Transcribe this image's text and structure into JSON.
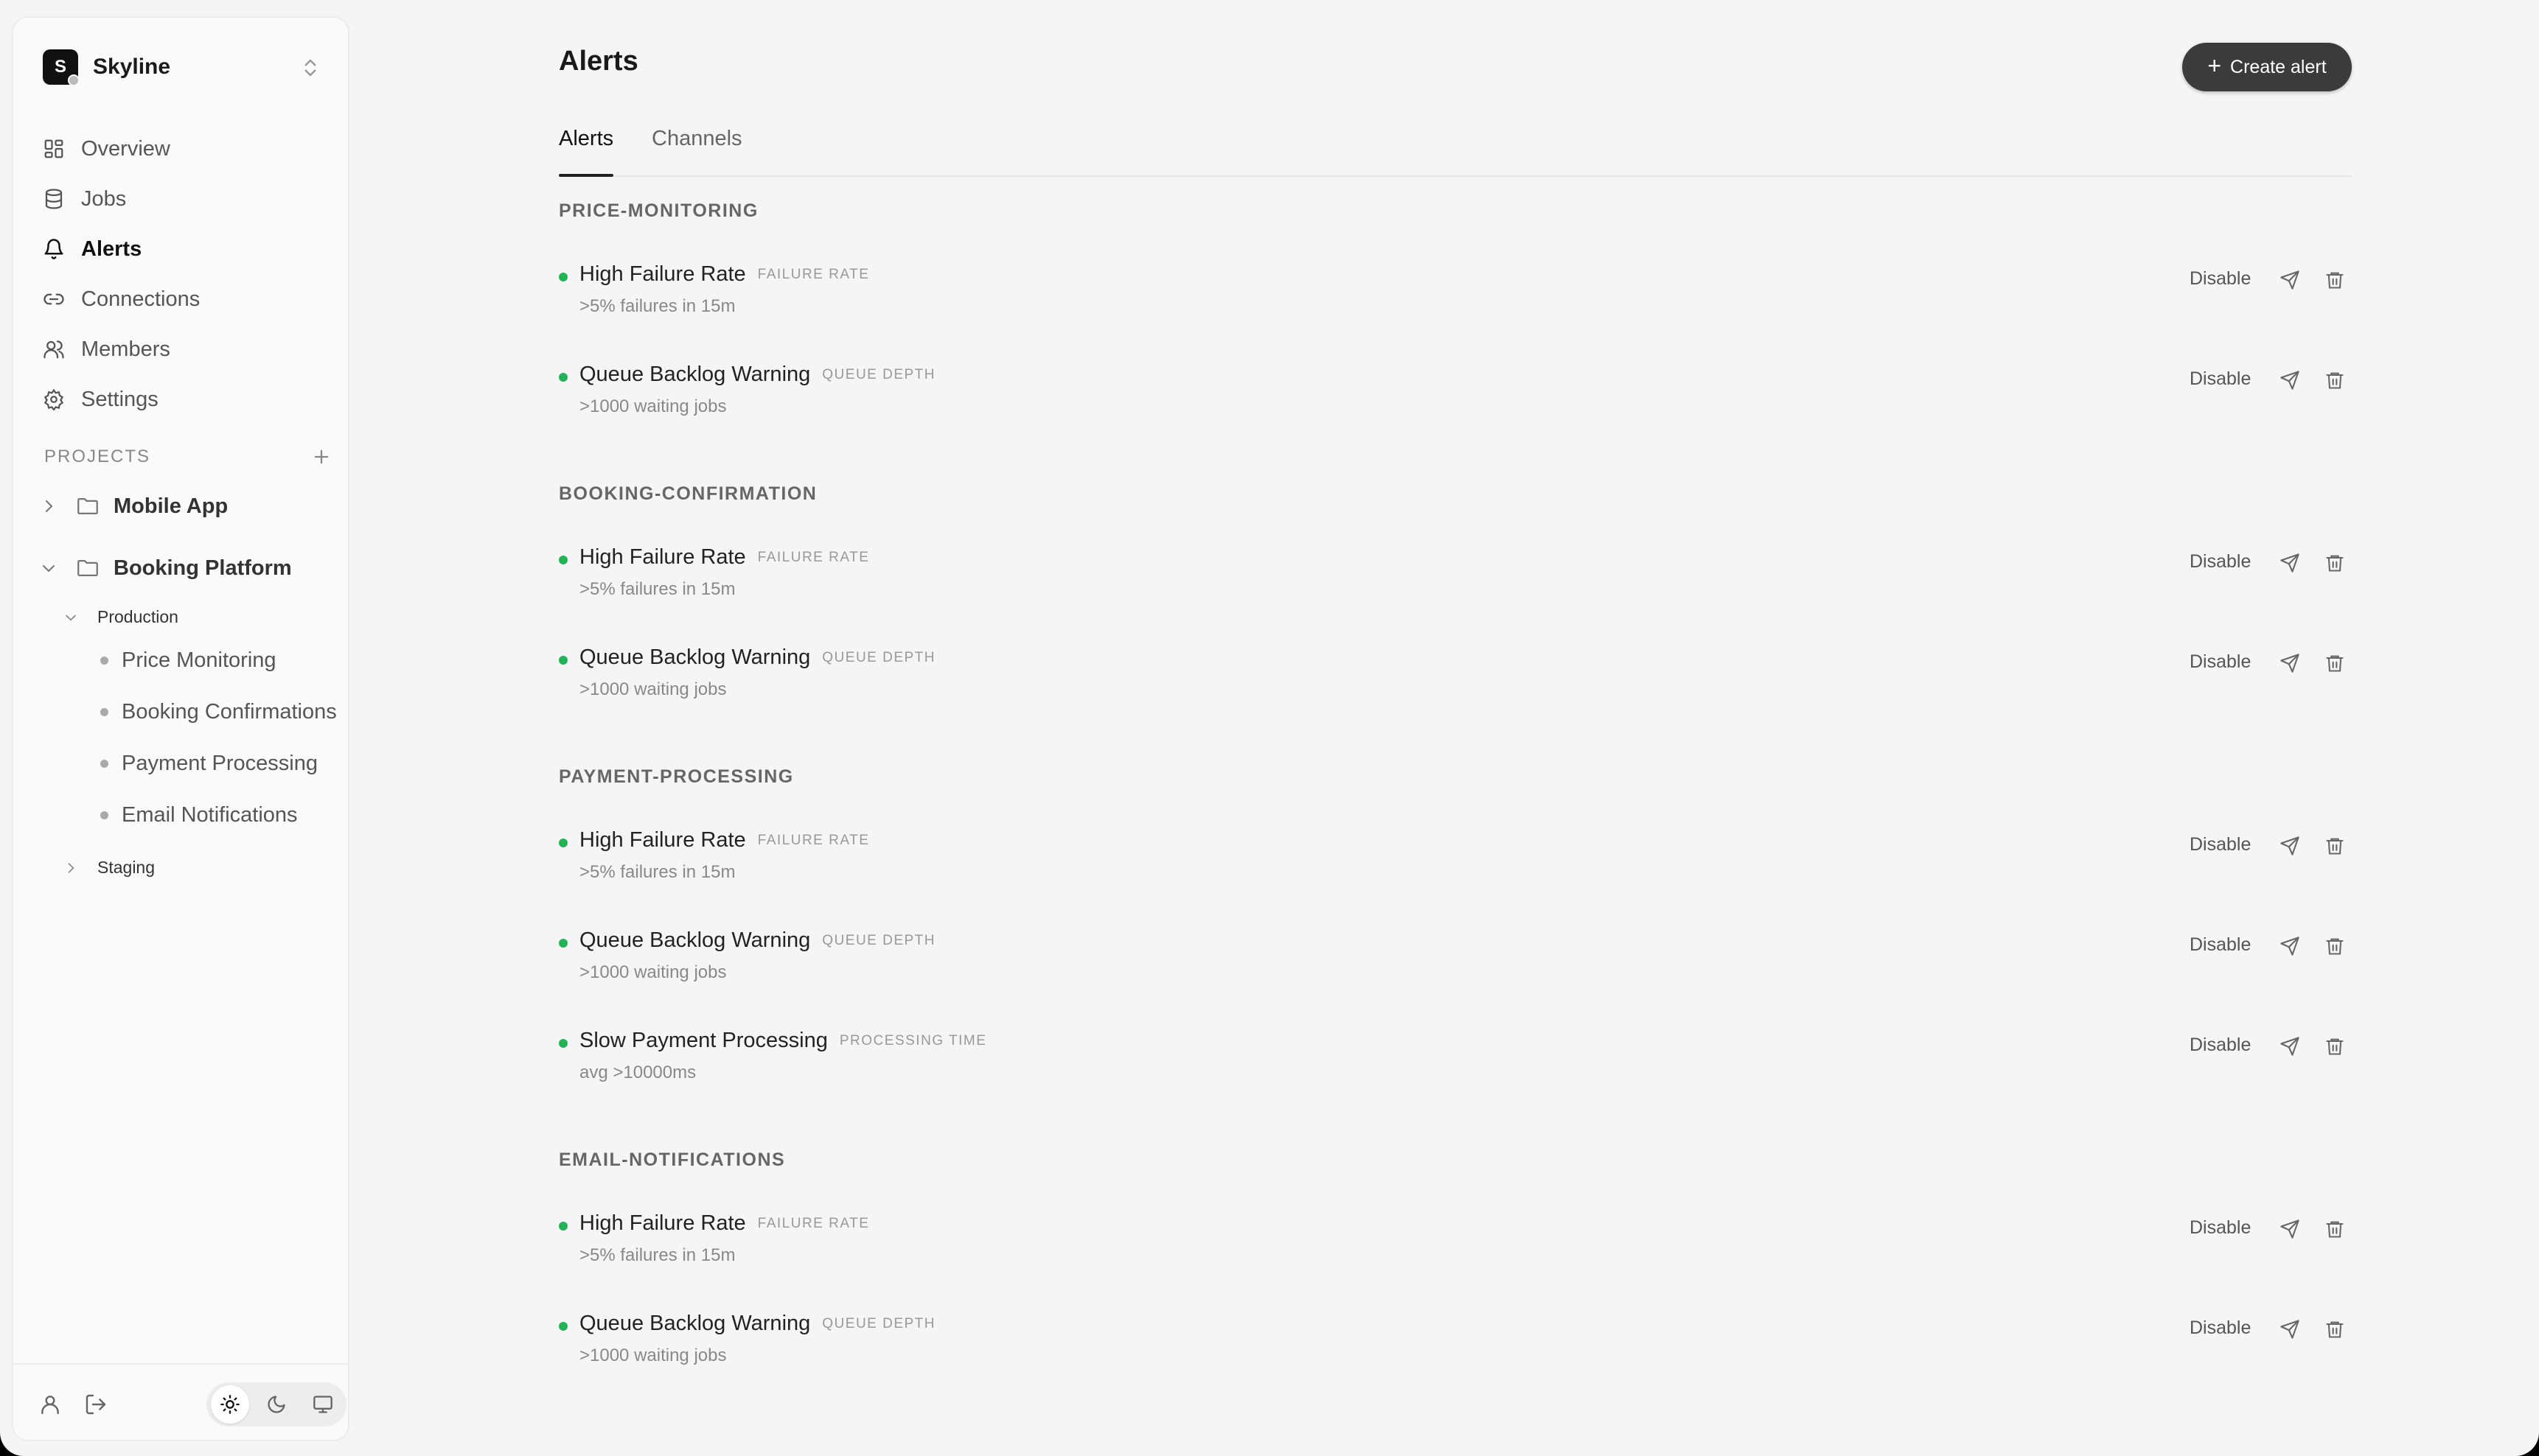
{
  "brand": {
    "logo_letter": "S",
    "name": "Skyline"
  },
  "nav": [
    {
      "label": "Overview",
      "icon": "grid-icon",
      "active": false
    },
    {
      "label": "Jobs",
      "icon": "database-icon",
      "active": false
    },
    {
      "label": "Alerts",
      "icon": "bell-icon",
      "active": true
    },
    {
      "label": "Connections",
      "icon": "link-icon",
      "active": false
    },
    {
      "label": "Members",
      "icon": "users-icon",
      "active": false
    },
    {
      "label": "Settings",
      "icon": "gear-icon",
      "active": false
    }
  ],
  "projects": {
    "title": "PROJECTS",
    "items": [
      {
        "label": "Mobile App",
        "expanded": false
      },
      {
        "label": "Booking Platform",
        "expanded": true,
        "environments": [
          {
            "label": "Production",
            "expanded": true,
            "leaves": [
              "Price Monitoring",
              "Booking Confirmations",
              "Payment Processing",
              "Email Notifications"
            ]
          },
          {
            "label": "Staging",
            "expanded": false
          }
        ]
      }
    ]
  },
  "page": {
    "title": "Alerts",
    "create_label": "Create alert"
  },
  "tabs": [
    {
      "label": "Alerts",
      "active": true
    },
    {
      "label": "Channels",
      "active": false
    }
  ],
  "groups": [
    {
      "name": "PRICE-MONITORING",
      "alerts": [
        {
          "name": "High Failure Rate",
          "type": "FAILURE RATE",
          "condition": ">5% failures in 15m"
        },
        {
          "name": "Queue Backlog Warning",
          "type": "QUEUE DEPTH",
          "condition": ">1000 waiting jobs"
        }
      ]
    },
    {
      "name": "BOOKING-CONFIRMATION",
      "alerts": [
        {
          "name": "High Failure Rate",
          "type": "FAILURE RATE",
          "condition": ">5% failures in 15m"
        },
        {
          "name": "Queue Backlog Warning",
          "type": "QUEUE DEPTH",
          "condition": ">1000 waiting jobs"
        }
      ]
    },
    {
      "name": "PAYMENT-PROCESSING",
      "alerts": [
        {
          "name": "High Failure Rate",
          "type": "FAILURE RATE",
          "condition": ">5% failures in 15m"
        },
        {
          "name": "Queue Backlog Warning",
          "type": "QUEUE DEPTH",
          "condition": ">1000 waiting jobs"
        },
        {
          "name": "Slow Payment Processing",
          "type": "PROCESSING TIME",
          "condition": "avg >10000ms"
        }
      ]
    },
    {
      "name": "EMAIL-NOTIFICATIONS",
      "alerts": [
        {
          "name": "High Failure Rate",
          "type": "FAILURE RATE",
          "condition": ">5% failures in 15m"
        },
        {
          "name": "Queue Backlog Warning",
          "type": "QUEUE DEPTH",
          "condition": ">1000 waiting jobs"
        }
      ]
    }
  ],
  "row_action": {
    "disable_label": "Disable"
  },
  "theme": {
    "selected": "light",
    "options": [
      "sun-icon",
      "moon-icon",
      "monitor-icon"
    ]
  },
  "colors": {
    "active_status": "#22b457",
    "primary_button": "#3b3b3b"
  }
}
